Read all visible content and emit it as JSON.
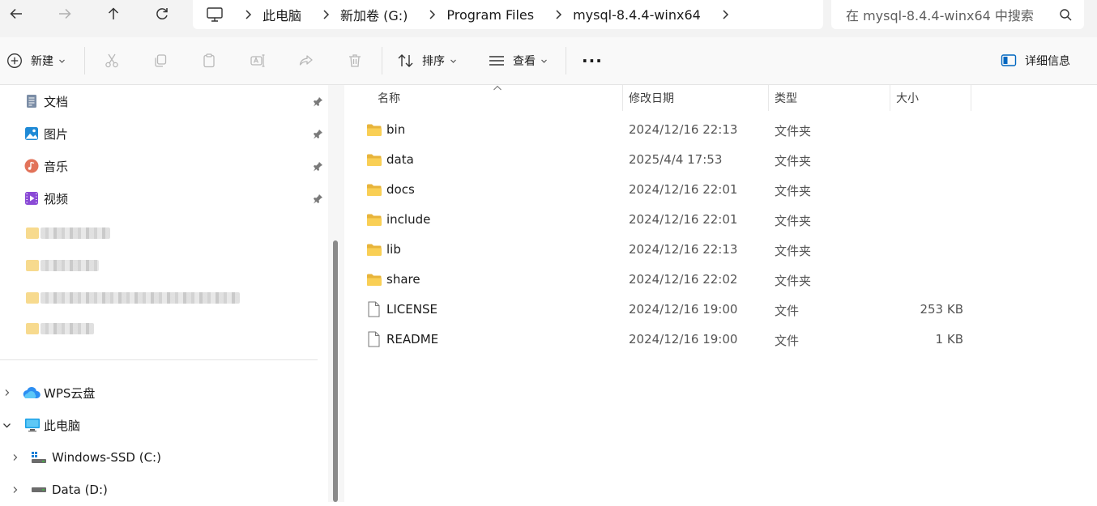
{
  "nav": {
    "back_icon": "arrow-left-icon",
    "forward_icon": "arrow-right-icon",
    "up_icon": "arrow-up-icon",
    "refresh_icon": "refresh-icon"
  },
  "address": {
    "root_icon": "computer-icon",
    "crumbs": [
      "此电脑",
      "新加卷 (G:)",
      "Program Files",
      "mysql-8.4.4-winx64"
    ]
  },
  "search": {
    "placeholder": "在 mysql-8.4.4-winx64 中搜索"
  },
  "toolbar": {
    "new_label": "新建",
    "sort_label": "排序",
    "view_label": "查看",
    "more_label": "···",
    "details_label": "详细信息"
  },
  "sidebar": {
    "quick": [
      {
        "label": "文档",
        "icon": "document-icon"
      },
      {
        "label": "图片",
        "icon": "picture-icon"
      },
      {
        "label": "音乐",
        "icon": "music-icon"
      },
      {
        "label": "视频",
        "icon": "video-icon"
      }
    ],
    "tree": [
      {
        "label": "WPS云盘",
        "icon": "cloud-icon"
      },
      {
        "label": "此电脑",
        "icon": "computer-icon"
      },
      {
        "label": "Windows-SSD (C:)",
        "icon": "drive-icon"
      },
      {
        "label": "Data (D:)",
        "icon": "drive-icon"
      }
    ]
  },
  "columns": {
    "name": "名称",
    "modified": "修改日期",
    "type": "类型",
    "size": "大小"
  },
  "files": [
    {
      "name": "bin",
      "date": "2024/12/16 22:13",
      "type": "文件夹",
      "size": "",
      "kind": "folder"
    },
    {
      "name": "data",
      "date": "2025/4/4 17:53",
      "type": "文件夹",
      "size": "",
      "kind": "folder"
    },
    {
      "name": "docs",
      "date": "2024/12/16 22:01",
      "type": "文件夹",
      "size": "",
      "kind": "folder"
    },
    {
      "name": "include",
      "date": "2024/12/16 22:01",
      "type": "文件夹",
      "size": "",
      "kind": "folder"
    },
    {
      "name": "lib",
      "date": "2024/12/16 22:13",
      "type": "文件夹",
      "size": "",
      "kind": "folder"
    },
    {
      "name": "share",
      "date": "2024/12/16 22:02",
      "type": "文件夹",
      "size": "",
      "kind": "folder"
    },
    {
      "name": "LICENSE",
      "date": "2024/12/16 19:00",
      "type": "文件",
      "size": "253 KB",
      "kind": "file"
    },
    {
      "name": "README",
      "date": "2024/12/16 19:00",
      "type": "文件",
      "size": "1 KB",
      "kind": "file"
    }
  ],
  "colors": {
    "folder": "#f7c84a",
    "accent": "#0067c0"
  }
}
